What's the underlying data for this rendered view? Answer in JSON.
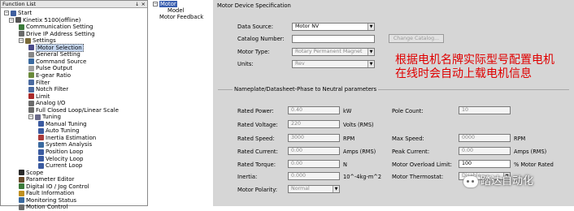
{
  "function_list": {
    "title": "Function List",
    "pin_glyph": "↓",
    "close_glyph": "×",
    "items": [
      {
        "label": "Start",
        "exp": "−",
        "color": "#3f5f9f"
      },
      {
        "label": "Kinetix 5100(offline)",
        "exp": "−",
        "color": "#555555"
      },
      {
        "label": "Communication Setting",
        "exp": "",
        "color": "#3a7a3a"
      },
      {
        "label": "Drive IP Address Setting",
        "exp": "",
        "color": "#6a6a6a"
      },
      {
        "label": "Settings",
        "exp": "−",
        "color": "#7a6a3a"
      },
      {
        "label": "Motor Selection",
        "exp": "",
        "color": "#4a4a8a"
      },
      {
        "label": "General Setting",
        "exp": "",
        "color": "#888888"
      },
      {
        "label": "Command Source",
        "exp": "",
        "color": "#3a6aa0"
      },
      {
        "label": "Pulse Output",
        "exp": "",
        "color": "#a0a0a0"
      },
      {
        "label": "E-gear Ratio",
        "exp": "",
        "color": "#6a8a3a"
      },
      {
        "label": "Filter",
        "exp": "",
        "color": "#4a6aa0"
      },
      {
        "label": "Notch Filter",
        "exp": "",
        "color": "#4a6aa0"
      },
      {
        "label": "Limit",
        "exp": "",
        "color": "#aa2a2a"
      },
      {
        "label": "Analog I/O",
        "exp": "",
        "color": "#6a6a6a"
      },
      {
        "label": "Full Closed Loop/Linear Scale",
        "exp": "",
        "color": "#6a6a6a"
      },
      {
        "label": "Tuning",
        "exp": "−",
        "color": "#6a6a8a"
      },
      {
        "label": "Manual Tuning",
        "exp": "",
        "color": "#3a5aa0"
      },
      {
        "label": "Auto Tuning",
        "exp": "",
        "color": "#3a5aa0"
      },
      {
        "label": "Inertia Estimation",
        "exp": "",
        "color": "#aa3a3a"
      },
      {
        "label": "System Analysis",
        "exp": "",
        "color": "#3a6aa0"
      },
      {
        "label": "Position Loop",
        "exp": "",
        "color": "#3a5aa0"
      },
      {
        "label": "Velocity Loop",
        "exp": "",
        "color": "#3a5aa0"
      },
      {
        "label": "Current Loop",
        "exp": "",
        "color": "#3a5aa0"
      },
      {
        "label": "Scope",
        "exp": "",
        "color": "#2a2a2a"
      },
      {
        "label": "Parameter Editor",
        "exp": "",
        "color": "#6a4a2a"
      },
      {
        "label": "Digital IO / Jog Control",
        "exp": "",
        "color": "#3a7a3a"
      },
      {
        "label": "Fault Information",
        "exp": "",
        "color": "#c09020"
      },
      {
        "label": "Monitoring Status",
        "exp": "",
        "color": "#3a6aa0"
      },
      {
        "label": "Motion Control",
        "exp": "",
        "color": "#6a6a6a"
      }
    ]
  },
  "tree": {
    "root": "Motor",
    "children": [
      "Model",
      "Motor Feedback"
    ]
  },
  "form": {
    "title": "Motor Device Specification",
    "data_source_label": "Data Source:",
    "data_source_value": "Motor NV",
    "catalog_label": "Catalog Number:",
    "catalog_value": "",
    "change_catalog": "Change Catalog...",
    "motor_type_label": "Motor Type:",
    "motor_type_value": "Rotary Permanent Magnet",
    "units_label": "Units:",
    "units_value": "Rev",
    "nameplate_title": "Nameplate/Datasheet-Phase to Neutral parameters",
    "rated_power_label": "Rated Power:",
    "rated_power_value": "0.40",
    "rated_power_unit": "kW",
    "rated_voltage_label": "Rated Voltage:",
    "rated_voltage_value": "220",
    "rated_voltage_unit": "Volts (RMS)",
    "rated_speed_label": "Rated Speed:",
    "rated_speed_value": "3000",
    "rated_speed_unit": "RPM",
    "rated_current_label": "Rated Current:",
    "rated_current_value": "0.00",
    "rated_current_unit": "Amps (RMS)",
    "rated_torque_label": "Rated Torque:",
    "rated_torque_value": "0.00",
    "rated_torque_unit": "N",
    "inertia_label": "Inertia:",
    "inertia_value": "0.000",
    "inertia_unit": "10^-4kg-m^2",
    "polarity_label": "Motor Polarity:",
    "polarity_value": "Normal",
    "pole_count_label": "Pole Count:",
    "pole_count_value": "10",
    "max_speed_label": "Max Speed:",
    "max_speed_value": "0000",
    "max_speed_unit": "RPM",
    "peak_current_label": "Peak Current:",
    "peak_current_value": "0.00",
    "peak_current_unit": "Amps (RMS)",
    "overload_label": "Motor Overload Limit:",
    "overload_value": "100",
    "overload_unit": "% Motor Rated",
    "thermostat_label": "Motor Thermostat:",
    "thermostat_value": "Disable"
  },
  "annotation": {
    "line1": "根据电机名牌实际型号配置电机",
    "line2": "在线时会自动上载电机信息",
    "color": "#e00000"
  },
  "watermark": "踏达自动化"
}
